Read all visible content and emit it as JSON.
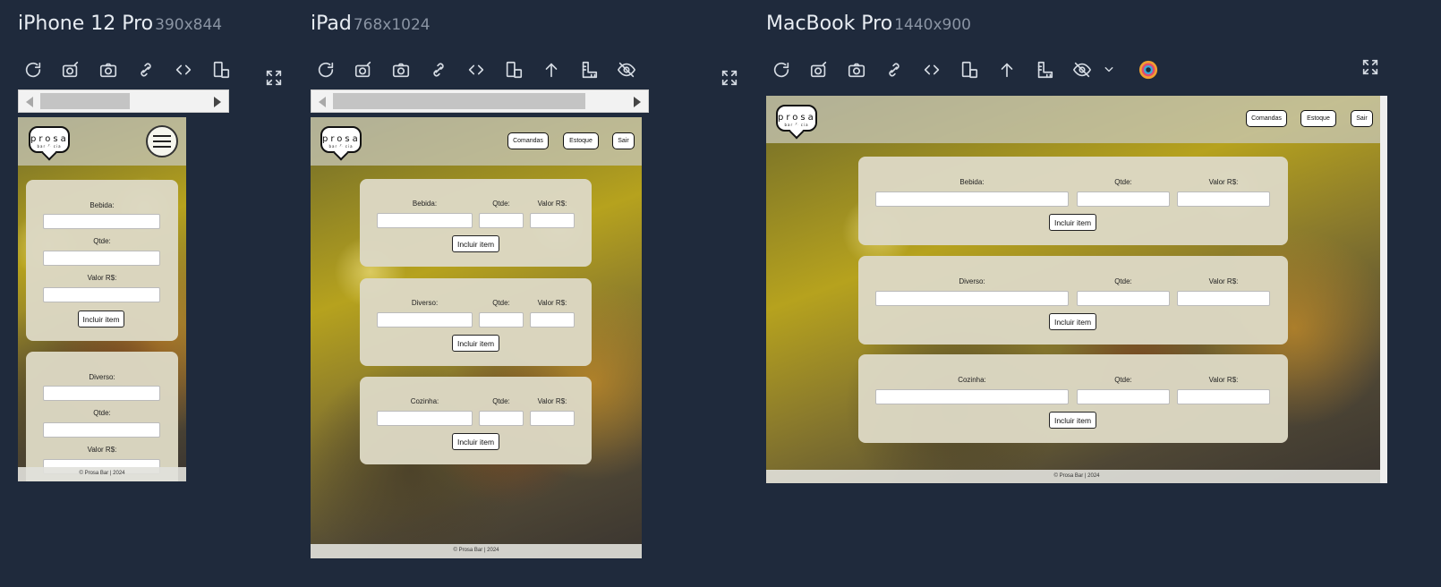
{
  "devices": {
    "iphone": {
      "name": "iPhone 12 Pro",
      "size": "390x844"
    },
    "ipad": {
      "name": "iPad",
      "size": "768x1024"
    },
    "macbook": {
      "name": "MacBook Pro",
      "size": "1440x900"
    }
  },
  "toolbar_icons": {
    "refresh": "refresh-icon",
    "screenshot_edit": "camera-edit-icon",
    "screenshot": "camera-icon",
    "sync": "link-sync-icon",
    "code": "code-icon",
    "rotate": "rotate-device-icon",
    "scroll_top": "arrow-up-icon",
    "ruler": "ruler-icon",
    "hide": "eye-slash-icon",
    "color": "color-picker-icon",
    "expand": "expand-icon"
  },
  "site": {
    "logo": "prosa",
    "logo_sub": "bar & cia",
    "nav": {
      "comandas": "Comandas",
      "estoque": "Estoque",
      "sair": "Sair"
    },
    "footer": "© Prosa Bar | 2024",
    "footer_mac": "© Prosa Bar | 2024",
    "sections": [
      {
        "label": "Bebida:",
        "qty_label": "Qtde:",
        "value_label": "Valor R$:",
        "button": "Incluir item"
      },
      {
        "label": "Diverso:",
        "qty_label": "Qtde:",
        "value_label": "Valor R$:",
        "button": "Incluir item"
      },
      {
        "label": "Cozinha:",
        "qty_label": "Qtde:",
        "value_label": "Valor R$:",
        "button": "Incluir item"
      }
    ]
  },
  "colors": {
    "background": "#1f2a3c",
    "card": "#dcd8c3"
  }
}
